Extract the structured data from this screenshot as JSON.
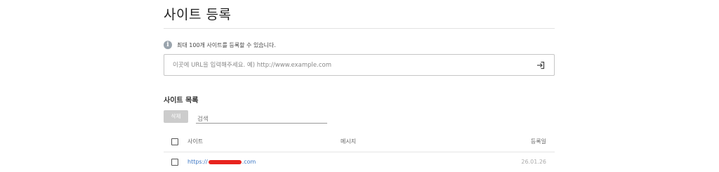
{
  "page": {
    "title": "사이트 등록"
  },
  "info": {
    "icon": "info-icon",
    "text": "최대 100개 사이트를 등록할 수 있습니다."
  },
  "url_input": {
    "placeholder": "이곳에 URL을 입력해주세요. 예) http://www.example.com",
    "value": "",
    "submit_icon": "enter-icon"
  },
  "site_list": {
    "title": "사이트 목록",
    "delete_label": "삭제",
    "search_placeholder": "검색",
    "columns": {
      "site": "사이트",
      "message": "메시지",
      "date": "등록일"
    },
    "rows": [
      {
        "site_prefix": "https://",
        "site_suffix": ".com",
        "site_redacted": true,
        "message": "",
        "date": "26.01.26"
      }
    ]
  },
  "colors": {
    "link": "#3b76c4",
    "redaction": "#e8231e",
    "delete_button": "#cccccc"
  }
}
